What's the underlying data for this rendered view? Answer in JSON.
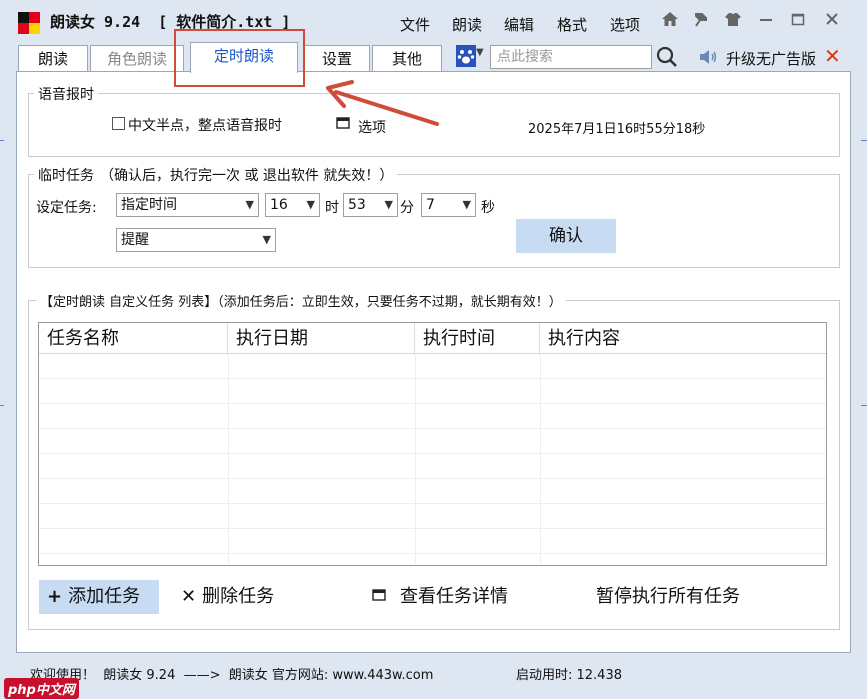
{
  "app": {
    "title": "朗读女 9.24  [ 软件简介.txt ]",
    "menu": [
      "文件",
      "朗读",
      "编辑",
      "格式",
      "选项"
    ]
  },
  "tabs": [
    {
      "label": "朗读",
      "active": false
    },
    {
      "label": "角色朗读",
      "active": false
    },
    {
      "label": "定时朗读",
      "active": true
    },
    {
      "label": "设置",
      "active": false
    },
    {
      "label": "其他",
      "active": false
    }
  ],
  "search": {
    "placeholder": "点此搜索"
  },
  "upgrade_label": "升级无广告版",
  "voice_time": {
    "legend": "语音报时",
    "checkbox_label": "中文半点，整点语音报时",
    "checkbox_checked": false,
    "options_label": "选项",
    "datetime": "2025年7月1日16时55分18秒"
  },
  "temp_task": {
    "legend": "临时任务",
    "note": "（确认后，执行完一次 或 退出软件 就失效！）",
    "set_label": "设定任务:",
    "mode": "指定时间",
    "hour": "16",
    "hour_unit": "时",
    "minute": "53",
    "minute_unit": "分",
    "second": "7",
    "second_unit": "秒",
    "action": "提醒",
    "confirm_label": "确认"
  },
  "custom_list": {
    "legend": "【定时朗读  自定义任务 列表】（添加任务后：立即生效，只要任务不过期，就长期有效！）",
    "columns": [
      "任务名称",
      "执行日期",
      "执行时间",
      "执行内容"
    ],
    "rows": []
  },
  "actions": {
    "add": "添加任务",
    "delete": "删除任务",
    "details": "查看任务详情",
    "pause_all": "暂停执行所有任务"
  },
  "status": {
    "welcome": "欢迎使用！  朗读女 9.24  ——>  朗读女 官方网站: www.443w.com",
    "uptime": "启动用时: 12.438"
  },
  "watermark": "php中文网",
  "colors": {
    "accent": "#1a58c8",
    "highlight": "#cf4b3a",
    "button_bg": "#c7dcf3"
  }
}
